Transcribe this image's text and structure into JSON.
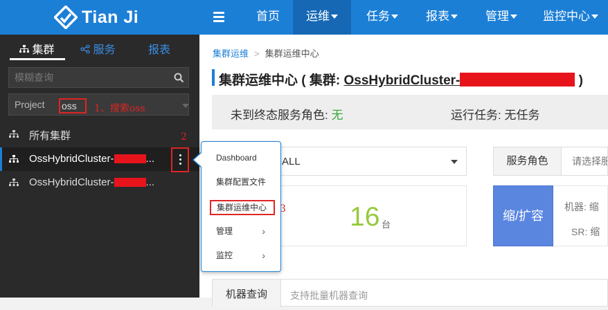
{
  "brand": {
    "name": "Tian Ji"
  },
  "nav": {
    "items": [
      {
        "label": "首页",
        "dropdown": false,
        "active": false
      },
      {
        "label": "运维",
        "dropdown": true,
        "active": true
      },
      {
        "label": "任务",
        "dropdown": true,
        "active": false
      },
      {
        "label": "报表",
        "dropdown": true,
        "active": false
      },
      {
        "label": "管理",
        "dropdown": true,
        "active": false
      },
      {
        "label": "监控中心",
        "dropdown": true,
        "active": false
      }
    ]
  },
  "sidebar": {
    "tabs": [
      {
        "label": "集群",
        "icon": "cluster-icon",
        "active": true
      },
      {
        "label": "服务",
        "icon": "share-icon",
        "active": false
      },
      {
        "label": "报表",
        "active": false
      }
    ],
    "search_placeholder": "模糊查询",
    "project_label": "Project",
    "project_value": "oss",
    "tree": [
      {
        "label": "所有集群",
        "selected": false
      },
      {
        "label": "OssHybridCluster-",
        "suffix": "...",
        "selected": true
      },
      {
        "label": "OssHybridCluster-",
        "suffix": "...",
        "selected": false
      }
    ]
  },
  "annotations": {
    "step1": "1、搜索oss",
    "step2": "2",
    "step3": "3"
  },
  "popup_menu": {
    "items": [
      {
        "label": "Dashboard",
        "has_submenu": false
      },
      {
        "label": "集群配置文件",
        "has_submenu": false
      },
      {
        "label": "集群运维中心",
        "has_submenu": false,
        "highlighted": true
      },
      {
        "label": "管理",
        "has_submenu": true
      },
      {
        "label": "监控",
        "has_submenu": true
      }
    ],
    "chevron": "›"
  },
  "main": {
    "breadcrumb": {
      "parent": "集群运维",
      "separator": ">",
      "current": "集群运维中心"
    },
    "title_prefix": "集群运维中心 ( 集群: ",
    "title_cluster": "OssHybridCluster-",
    "title_suffix": " )",
    "status": {
      "unfinished_label": "未到终态服务角色: ",
      "unfinished_value": "无",
      "running_label": "运行任务: ",
      "running_value": "无任务"
    },
    "filter_value": "ALL",
    "machine_count": "16",
    "machine_unit": "台",
    "role_label": "服务角色",
    "role_placeholder": "请选择服",
    "scale_button": "缩/扩容",
    "scale_info_line1": "机器: 缩",
    "scale_info_line2": "SR: 缩",
    "bottom_tab": "机器查询",
    "bottom_placeholder": "支持批量机器查询"
  },
  "colors": {
    "topbar": "#1c7fd6",
    "nav_active": "#1668b4",
    "sidebar_bg": "#2a2a2a",
    "redaction": "#e8141c",
    "annotation": "#e02424",
    "count_green": "#96c93d",
    "scale_button": "#5a86e0"
  }
}
